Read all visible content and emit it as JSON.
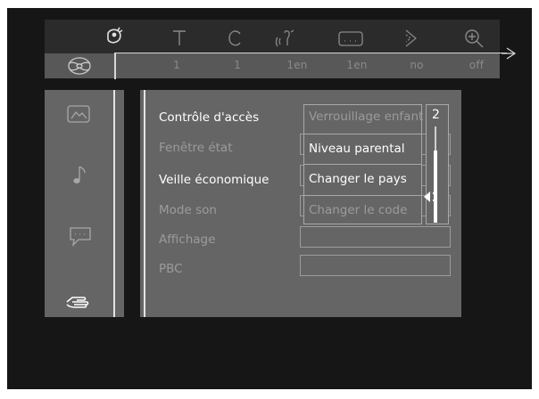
{
  "status_bar": {
    "icons": [
      "camera-angle-icon",
      "title-icon",
      "chapter-icon",
      "audio-icon",
      "subtitle-icon",
      "angle-icon",
      "zoom-icon"
    ],
    "disc_icon": "disc-icon",
    "values": [
      "1",
      "1",
      "1en",
      "1en",
      "no",
      "off"
    ]
  },
  "sidebar": {
    "items": [
      "picture-settings-icon",
      "audio-settings-icon",
      "language-settings-icon",
      "preferences-settings-icon"
    ],
    "active_item": "preferences-settings-icon"
  },
  "menu": {
    "items": [
      {
        "label": "Contrôle d'accès",
        "state": "active"
      },
      {
        "label": "Fenêtre état",
        "state": "dim"
      },
      {
        "label": "Veille économique",
        "state": "active"
      },
      {
        "label": "Mode son",
        "state": "dim"
      },
      {
        "label": "Affichage",
        "state": "dim"
      },
      {
        "label": "PBC",
        "state": "dim"
      }
    ]
  },
  "submenu": {
    "items": [
      {
        "label": "Verrouillage enfant",
        "state": "dim"
      },
      {
        "label": "Niveau parental",
        "state": "active"
      },
      {
        "label": "Changer le pays",
        "state": "active"
      },
      {
        "label": "Changer le code",
        "state": "dim"
      }
    ]
  },
  "parental_level": {
    "value": "2",
    "min": 0,
    "max": 8,
    "fraction": 0.75
  },
  "colors": {
    "panel": "#656565",
    "active_text": "#ffffff",
    "dim_text": "#9b9b9b"
  }
}
